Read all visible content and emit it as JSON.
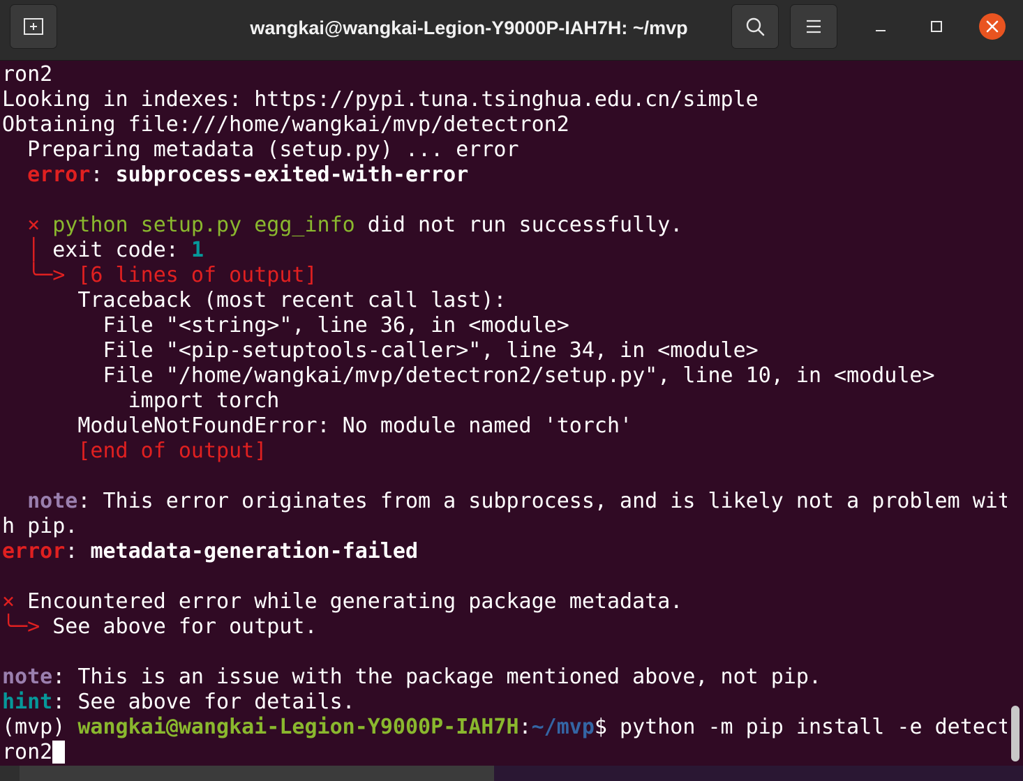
{
  "window": {
    "title": "wangkai@wangkai-Legion-Y9000P-IAH7H: ~/mvp",
    "close_color": "#e95420"
  },
  "terminal": {
    "l01": "ron2",
    "l02": "Looking in indexes: https://pypi.tuna.tsinghua.edu.cn/simple",
    "l03": "Obtaining file:///home/wangkai/mvp/detectron2",
    "l04": "  Preparing metadata (setup.py) ... error",
    "l05_a": "  ",
    "l05_b": "error",
    "l05_c": ": ",
    "l05_d": "subprocess-exited-with-error",
    "l07_a": "  ",
    "l07_b": "×",
    "l07_c": " ",
    "l07_d": "python setup.py egg_info",
    "l07_e": " did not run successfully.",
    "l08_a": "  │ ",
    "l08_b": "exit code: ",
    "l08_c": "1",
    "l09_a": "  ╰─> ",
    "l09_b": "[6 lines of output]",
    "l10": "      Traceback (most recent call last):",
    "l11": "        File \"<string>\", line 36, in <module>",
    "l12": "        File \"<pip-setuptools-caller>\", line 34, in <module>",
    "l13": "        File \"/home/wangkai/mvp/detectron2/setup.py\", line 10, in <module>",
    "l14": "          import torch",
    "l15": "      ModuleNotFoundError: No module named 'torch'",
    "l16_a": "      ",
    "l16_b": "[end of output]",
    "l18_a": "  ",
    "l18_b": "note",
    "l18_c": ": This error originates from a subprocess, and is likely not a problem wit",
    "l19": "h pip.",
    "l20_a": "error",
    "l20_b": ": ",
    "l20_c": "metadata-generation-failed",
    "l22_a": "×",
    "l22_b": " Encountered error while generating package metadata.",
    "l23_a": "╰─> ",
    "l23_b": "See above for output.",
    "l25_a": "note",
    "l25_b": ": This is an issue with the package mentioned above, not pip.",
    "l26_a": "hint",
    "l26_b": ": See above for details.",
    "prompt_env": "(mvp) ",
    "prompt_user": "wangkai@wangkai-Legion-Y9000P-IAH7H",
    "prompt_colon": ":",
    "prompt_path": "~/mvp",
    "prompt_dollar": "$ ",
    "command": "python -m pip install -e detect",
    "command_cont": "ron2"
  }
}
